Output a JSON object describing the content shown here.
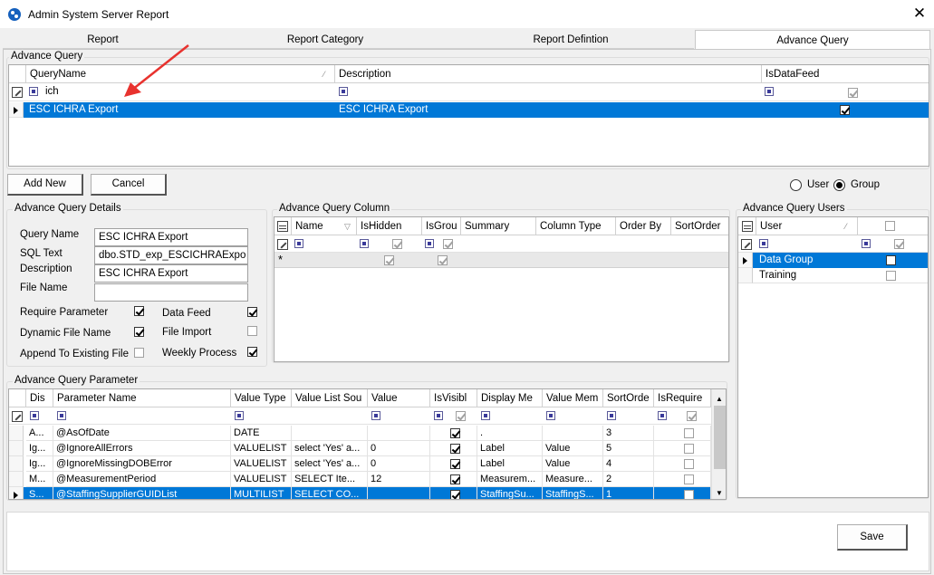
{
  "window": {
    "title": "Admin System Server Report",
    "close": "✕"
  },
  "tabs": [
    "Report",
    "Report Category",
    "Report Defintion",
    "Advance Query"
  ],
  "advance_query": {
    "group_title": "Advance Query",
    "columns": [
      "QueryName",
      "Description",
      "IsDataFeed"
    ],
    "filter_text": "ich",
    "rows": [
      {
        "name": "ESC ICHRA Export",
        "description": "ESC ICHRA Export",
        "is_data_feed": true
      }
    ]
  },
  "buttons": {
    "add_new": "Add New",
    "cancel": "Cancel",
    "save": "Save"
  },
  "radio": {
    "user": "User",
    "group": "Group",
    "selected": "Group"
  },
  "details": {
    "title": "Advance Query Details",
    "query_name_label": "Query  Name",
    "query_name": "ESC ICHRA Export",
    "sql_text_label": "SQL Text",
    "sql_text": "dbo.STD_exp_ESCICHRAExpo",
    "description_label": "Description",
    "description": "ESC ICHRA Export",
    "file_name_label": "File Name",
    "file_name": "",
    "require_parameter": "Require Parameter",
    "data_feed": "Data Feed",
    "dynamic_file_name": "Dynamic File Name",
    "file_import": "File Import",
    "append_existing": "Append To Existing File",
    "weekly_process": "Weekly Process"
  },
  "column_grid": {
    "title": "Advance Query Column",
    "columns": [
      "Name",
      "IsHidden",
      "IsGrou",
      "Summary",
      "Column Type",
      "Order By",
      "SortOrder"
    ]
  },
  "users": {
    "title": "Advance Query Users",
    "columns": [
      "User"
    ],
    "rows": [
      {
        "name": "Data Group",
        "checked": false
      },
      {
        "name": "Training",
        "checked": false
      }
    ]
  },
  "params": {
    "title": "Advance Query Parameter",
    "columns": [
      "Dis",
      "Parameter Name",
      "Value Type",
      "Value List Sou",
      "Value",
      "IsVisibl",
      "Display Me",
      "Value Mem",
      "SortOrde",
      "IsRequire"
    ],
    "rows": [
      {
        "dis": "A...",
        "name": "@AsOfDate",
        "type": "DATE",
        "source": "",
        "value": "",
        "visible": true,
        "display": ".",
        "member": "",
        "sort": "3",
        "required": false
      },
      {
        "dis": "Ig...",
        "name": "@IgnoreAllErrors",
        "type": "VALUELIST",
        "source": "select 'Yes' a...",
        "value": "0",
        "visible": true,
        "display": "Label",
        "member": "Value",
        "sort": "5",
        "required": false
      },
      {
        "dis": "Ig...",
        "name": "@IgnoreMissingDOBError",
        "type": "VALUELIST",
        "source": "select 'Yes' a...",
        "value": "0",
        "visible": true,
        "display": "Label",
        "member": "Value",
        "sort": "4",
        "required": false
      },
      {
        "dis": "M...",
        "name": "@MeasurementPeriod",
        "type": "VALUELIST",
        "source": "SELECT  Ite...",
        "value": "12",
        "visible": true,
        "display": "Measurem...",
        "member": "Measure...",
        "sort": "2",
        "required": false
      },
      {
        "dis": "S...",
        "name": "@StaffingSupplierGUIDList",
        "type": "MULTILIST",
        "source": "SELECT  CO...",
        "value": "",
        "visible": true,
        "display": "StaffingSu...",
        "member": "StaffingS...",
        "sort": "1",
        "required": false
      }
    ]
  }
}
